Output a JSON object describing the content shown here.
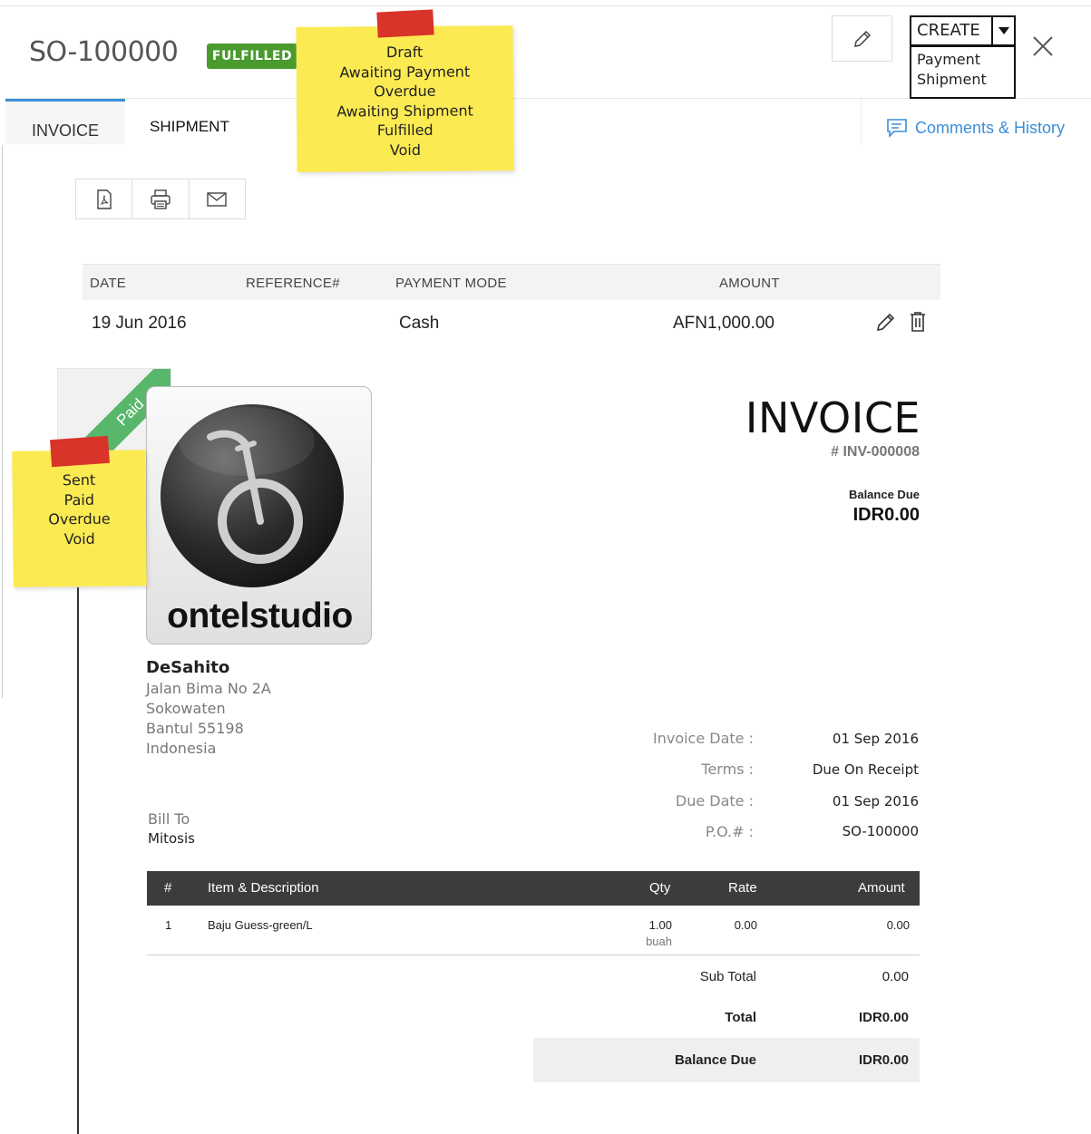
{
  "header": {
    "so_number": "SO-100000",
    "status_badge": "FULFILLED",
    "create_label": "CREATE",
    "create_menu": [
      "Payment",
      "Shipment"
    ]
  },
  "tabs": {
    "invoice": "INVOICE",
    "shipment": "SHIPMENT",
    "comments": "Comments & History"
  },
  "sticky_notes": {
    "top": [
      "Draft",
      "Awaiting Payment",
      "Overdue",
      "Awaiting Shipment",
      "Fulfilled",
      "Void"
    ],
    "left": [
      "Sent",
      "Paid",
      "Overdue",
      "Void"
    ]
  },
  "payments": {
    "columns": {
      "date": "DATE",
      "reference": "REFERENCE#",
      "mode": "PAYMENT MODE",
      "amount": "AMOUNT"
    },
    "rows": [
      {
        "date": "19 Jun 2016",
        "reference": "",
        "mode": "Cash",
        "amount": "AFN1,000.00"
      }
    ]
  },
  "ribbon": "Paid",
  "logo_text": "ontelstudio",
  "invoice": {
    "title": "INVOICE",
    "number": "# INV-000008",
    "balance_due_label": "Balance Due",
    "balance_due_value": "IDR0.00"
  },
  "org": {
    "name": "DeSahito",
    "address": [
      "Jalan Bima No 2A",
      "Sokowaten",
      "Bantul  55198",
      "Indonesia"
    ]
  },
  "bill_to": {
    "label": "Bill To",
    "name": "Mitosis"
  },
  "meta": [
    {
      "label": "Invoice Date :",
      "value": "01 Sep 2016"
    },
    {
      "label": "Terms :",
      "value": "Due On Receipt"
    },
    {
      "label": "Due Date :",
      "value": "01 Sep 2016"
    },
    {
      "label": "P.O.# :",
      "value": "SO-100000"
    }
  ],
  "items": {
    "columns": {
      "num": "#",
      "desc": "Item & Description",
      "qty": "Qty",
      "rate": "Rate",
      "amount": "Amount"
    },
    "rows": [
      {
        "num": "1",
        "desc": "Baju Guess-green/L",
        "qty": "1.00",
        "unit": "buah",
        "rate": "0.00",
        "amount": "0.00"
      }
    ]
  },
  "totals": {
    "sub_total_label": "Sub Total",
    "sub_total": "0.00",
    "total_label": "Total",
    "total": "IDR0.00",
    "balance_due_label": "Balance Due",
    "balance_due": "IDR0.00"
  },
  "colors": {
    "accent": "#3b8fd8",
    "badge": "#4a9a2e",
    "sticky": "#fcea53",
    "tape": "#d9342a",
    "ribbon": "#59b76b"
  }
}
